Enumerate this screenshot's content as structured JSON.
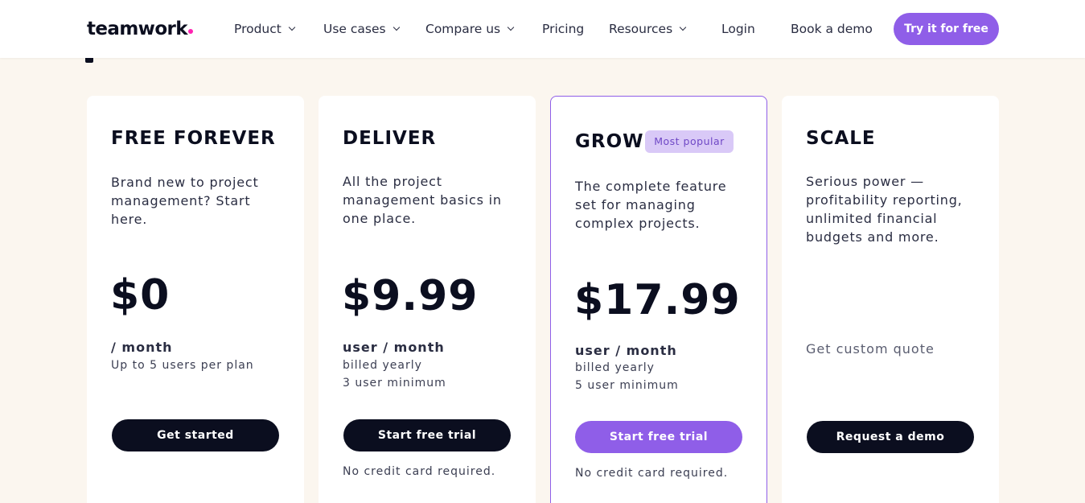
{
  "brand": {
    "name": "teamwork",
    "accent": "#ff22b1"
  },
  "nav": {
    "product": "Product",
    "use_cases": "Use cases",
    "compare": "Compare us",
    "pricing": "Pricing",
    "resources": "Resources",
    "login": "Login",
    "book_demo": "Book a demo",
    "try_free": "Try it for free"
  },
  "colors": {
    "primary": "#8f5ee8",
    "dark": "#0b0e1f",
    "background": "#fbf6ef"
  },
  "plans": [
    {
      "name": "FREE FOREVER",
      "description": "Brand new to project management? Start here.",
      "price": "$0",
      "unit": "/ month",
      "details": [
        "Up to 5 users per plan"
      ],
      "cta": "Get started",
      "note": ""
    },
    {
      "name": "DELIVER",
      "description": "All the project management basics in one place.",
      "price": "$9.99",
      "unit": "user / month",
      "details": [
        "billed yearly",
        "3 user minimum"
      ],
      "cta": "Start free trial",
      "note": "No credit card required."
    },
    {
      "name": "GROW",
      "badge": "Most popular",
      "description": "The complete feature set for managing complex projects.",
      "price": "$17.99",
      "unit": "user / month",
      "details": [
        "billed yearly",
        "5 user minimum"
      ],
      "cta": "Start free trial",
      "note": "No credit card required."
    },
    {
      "name": "SCALE",
      "description": "Serious power — profitability reporting, unlimited financial budgets and more.",
      "quote": "Get custom quote",
      "cta": "Request a demo",
      "note": ""
    }
  ]
}
